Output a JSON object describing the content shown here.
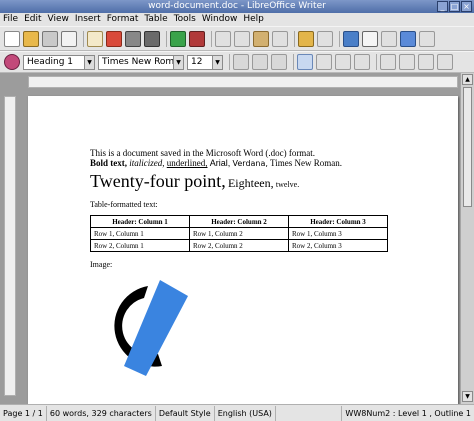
{
  "window": {
    "title": "word-document.doc - LibreOffice Writer"
  },
  "menu": [
    "File",
    "Edit",
    "View",
    "Insert",
    "Format",
    "Table",
    "Tools",
    "Window",
    "Help"
  ],
  "formatting": {
    "paragraph_style": "Heading 1",
    "font_name": "Times New Roman",
    "font_size": "12"
  },
  "document": {
    "line1": "This is a document saved in the Microsoft Word (.doc) format.",
    "line2": {
      "bold": "Bold text,",
      "italic": "italicized,",
      "underline": "underlined,",
      "arial": "Arial,",
      "verdana": "Verdana,",
      "times": "Times New Roman."
    },
    "line3": {
      "big": "Twenty-four point,",
      "med": "Eighteen,",
      "small": "twelve."
    },
    "table_caption": "Table-formatted text:",
    "table": {
      "headers": [
        "Header: Column 1",
        "Header: Column 2",
        "Header: Column 3"
      ],
      "rows": [
        [
          "Row 1, Column 1",
          "Row 1, Column 2",
          "Row 1, Column 3"
        ],
        [
          "Row 2, Column 1",
          "Row 2, Column 2",
          "Row 2, Column 3"
        ]
      ]
    },
    "image_caption": "Image:"
  },
  "status": {
    "page": "Page 1 / 1",
    "words": "60 words, 329 characters",
    "page_style": "Default Style",
    "language": "English (USA)",
    "outline": "WW8Num2 : Level 1 , Outline 1"
  },
  "colors": {
    "logo_dark": "#000000",
    "logo_accent": "#3a84e0",
    "titlebar": "#5a78b0"
  }
}
